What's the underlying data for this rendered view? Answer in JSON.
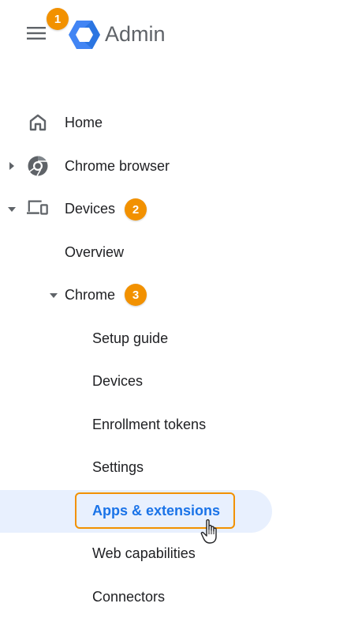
{
  "header": {
    "title": "Admin",
    "menu_icon": "hamburger-menu-icon",
    "logo_icon": "admin-hexagon-logo"
  },
  "badges": {
    "menu": "1",
    "devices": "2",
    "chrome": "3"
  },
  "nav": {
    "home": {
      "label": "Home",
      "icon": "home-icon"
    },
    "chrome_browser": {
      "label": "Chrome browser",
      "icon": "chrome-logo-icon"
    },
    "devices": {
      "label": "Devices",
      "icon": "devices-icon"
    },
    "overview": {
      "label": "Overview"
    },
    "chrome": {
      "label": "Chrome"
    },
    "chrome_children": {
      "setup_guide": "Setup guide",
      "devices": "Devices",
      "enrollment_tokens": "Enrollment tokens",
      "settings": "Settings",
      "apps_extensions": "Apps & extensions",
      "web_capabilities": "Web capabilities",
      "connectors": "Connectors"
    },
    "active_item": "Apps & extensions"
  },
  "colors": {
    "badge": "#f29100",
    "active_text": "#1a73e8",
    "active_bg": "#e8f0fe",
    "logo_outer": "#4285f4",
    "logo_inner": "#1967d2"
  }
}
